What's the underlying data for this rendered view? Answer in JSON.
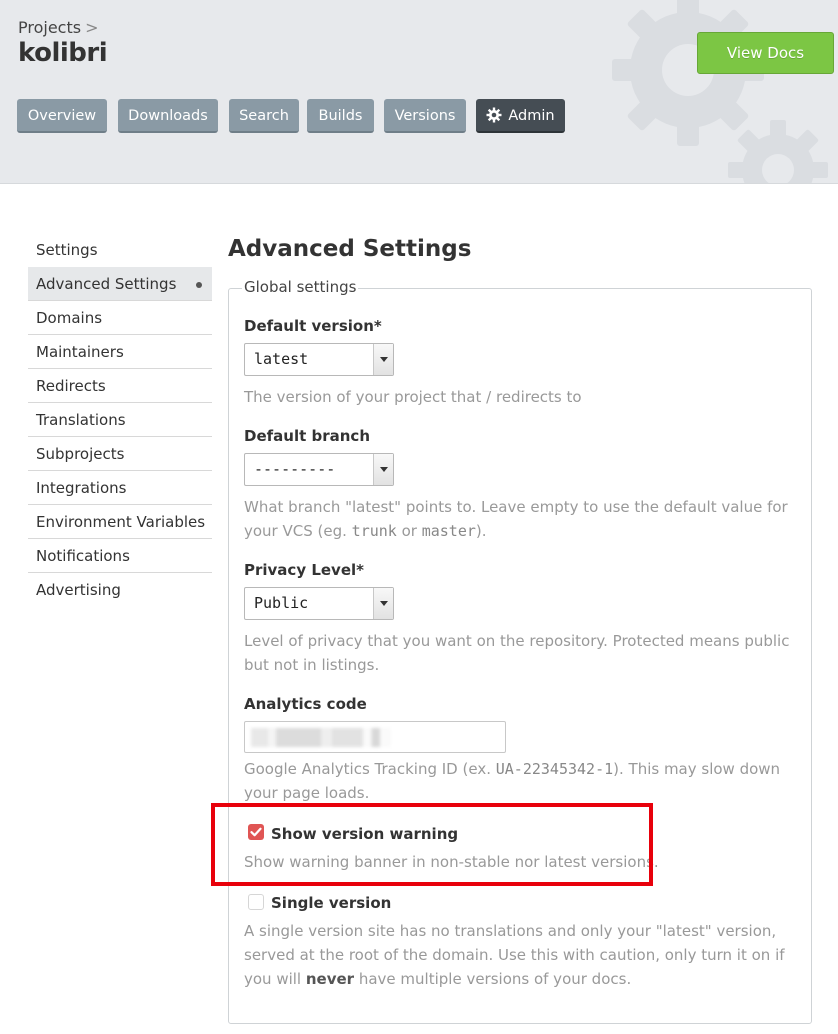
{
  "header": {
    "breadcrumb_parent": "Projects",
    "breadcrumb_separator": ">",
    "project_name": "kolibri",
    "view_docs_label": "View Docs",
    "tabs": [
      {
        "label": "Overview"
      },
      {
        "label": "Downloads"
      },
      {
        "label": "Search"
      },
      {
        "label": "Builds"
      },
      {
        "label": "Versions"
      },
      {
        "label": "Admin",
        "icon": "gear-icon",
        "active": true
      }
    ]
  },
  "sidebar": {
    "items": [
      {
        "label": "Settings"
      },
      {
        "label": "Advanced Settings",
        "active": true
      },
      {
        "label": "Domains"
      },
      {
        "label": "Maintainers"
      },
      {
        "label": "Redirects"
      },
      {
        "label": "Translations"
      },
      {
        "label": "Subprojects"
      },
      {
        "label": "Integrations"
      },
      {
        "label": "Environment Variables"
      },
      {
        "label": "Notifications"
      },
      {
        "label": "Advertising"
      }
    ]
  },
  "main": {
    "title": "Advanced Settings",
    "fieldset_legend": "Global settings",
    "default_version": {
      "label": "Default version*",
      "value": "latest",
      "help": "The version of your project that / redirects to"
    },
    "default_branch": {
      "label": "Default branch",
      "value": "---------",
      "help_before": "What branch \"latest\" points to. Leave empty to use the default value for your VCS (eg. ",
      "help_code1": "trunk",
      "help_mid": " or ",
      "help_code2": "master",
      "help_after": ")."
    },
    "privacy_level": {
      "label": "Privacy Level*",
      "value": "Public",
      "help": "Level of privacy that you want on the repository. Protected means public but not in listings."
    },
    "analytics_code": {
      "label": "Analytics code",
      "help_before": "Google Analytics Tracking ID (ex. ",
      "help_code": "UA-22345342-1",
      "help_after": "). This may slow down your page loads."
    },
    "show_version_warning": {
      "label": "Show version warning",
      "checked": true,
      "help": "Show warning banner in non-stable nor latest versions."
    },
    "single_version": {
      "label": "Single version",
      "checked": false,
      "help_before": "A single version site has no translations and only your \"latest\" version, served at the root of the domain. Use this with caution, only turn it on if you will ",
      "help_bold": "never",
      "help_after": " have multiple versions of your docs."
    }
  },
  "colors": {
    "view_docs_bg": "#7cc644",
    "tab_bg": "#8a9aa5",
    "tab_active_bg": "#454d54",
    "checkbox_checked": "#e05554",
    "highlight_border": "#e8000b"
  }
}
